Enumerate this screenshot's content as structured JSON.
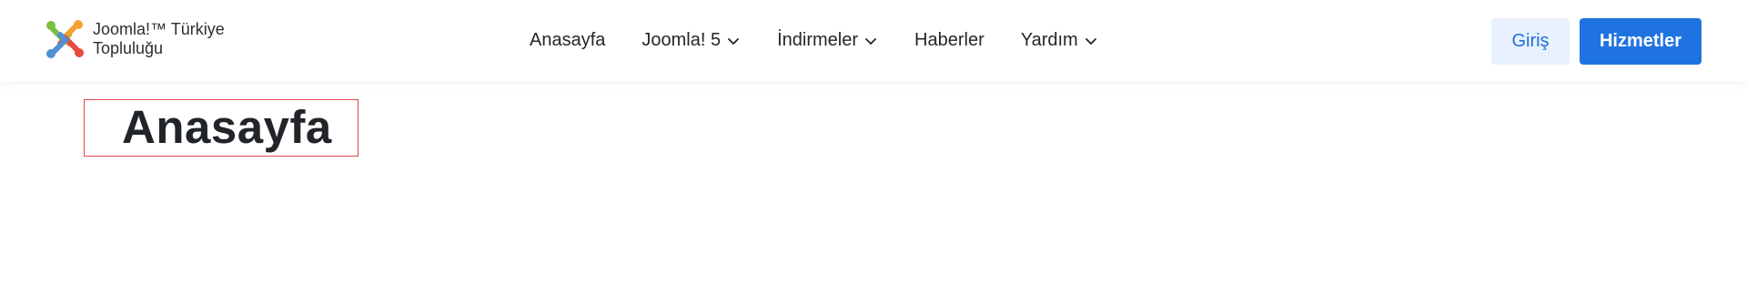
{
  "header": {
    "logo": {
      "icon": "joomla-logo-icon",
      "line1": "Joomla!™ Türkiye",
      "line2": "Topluluğu"
    },
    "nav": [
      {
        "label": "Anasayfa",
        "has_dropdown": false
      },
      {
        "label": "Joomla! 5",
        "has_dropdown": true,
        "icon": "chevron-down-icon"
      },
      {
        "label": "İndirmeler",
        "has_dropdown": true,
        "icon": "chevron-down-icon"
      },
      {
        "label": "Haberler",
        "has_dropdown": false
      },
      {
        "label": "Yardım",
        "has_dropdown": true,
        "icon": "chevron-down-icon"
      }
    ],
    "login_label": "Giriş",
    "services_label": "Hizmetler"
  },
  "main": {
    "title": "Anasayfa"
  },
  "colors": {
    "primary": "#1f73e0",
    "login_bg": "#e8f1fd",
    "login_text": "#1f6fd6",
    "title_outline": "#e24b4b",
    "text": "#22262a"
  }
}
